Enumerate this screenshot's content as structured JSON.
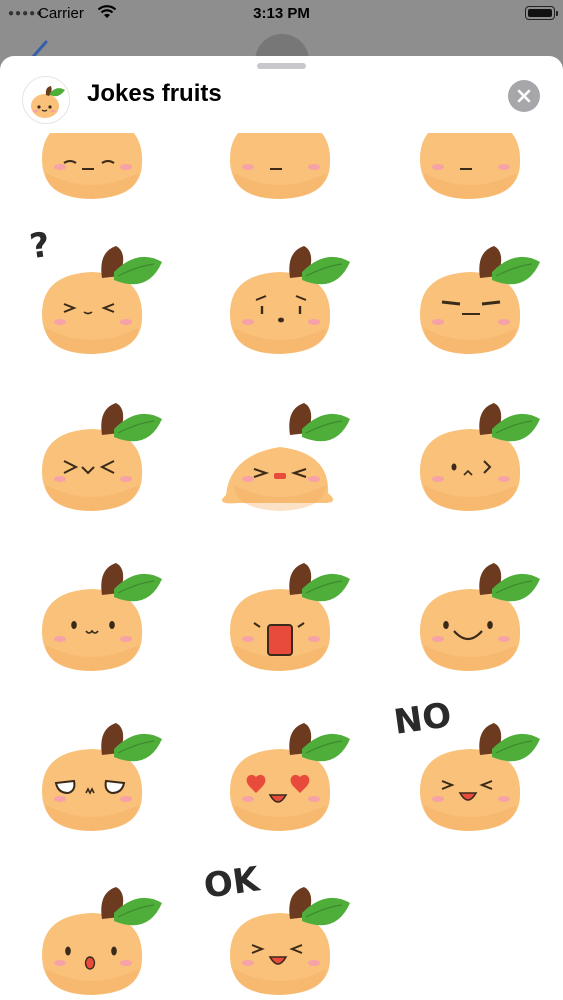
{
  "status_bar": {
    "carrier": "Carrier",
    "time": "3:13 PM",
    "signal_icon": "signal-dots-icon",
    "wifi_icon": "wifi-icon",
    "battery_icon": "battery-icon"
  },
  "sheet": {
    "title": "Jokes fruits",
    "close_icon": "close-icon",
    "app_icon": "orange-fruit-icon"
  },
  "stickers": [
    {
      "name": "sticker-sleepy-partial"
    },
    {
      "name": "sticker-partial-2"
    },
    {
      "name": "sticker-partial-3"
    },
    {
      "name": "sticker-question",
      "caption": "?"
    },
    {
      "name": "sticker-worried"
    },
    {
      "name": "sticker-annoyed"
    },
    {
      "name": "sticker-angry"
    },
    {
      "name": "sticker-melting"
    },
    {
      "name": "sticker-unhappy"
    },
    {
      "name": "sticker-cute"
    },
    {
      "name": "sticker-shouting"
    },
    {
      "name": "sticker-smile"
    },
    {
      "name": "sticker-blank-stare"
    },
    {
      "name": "sticker-heart-eyes"
    },
    {
      "name": "sticker-no",
      "caption": "NO"
    },
    {
      "name": "sticker-surprised"
    },
    {
      "name": "sticker-ok",
      "caption": "OK"
    }
  ],
  "colors": {
    "fruit_body": "#f9c17a",
    "fruit_shadow": "#f3ab5e",
    "stem": "#6b3a1f",
    "leaf": "#4fae3a",
    "blush": "#f7a1a8",
    "overlay": "#8e8e8e"
  }
}
